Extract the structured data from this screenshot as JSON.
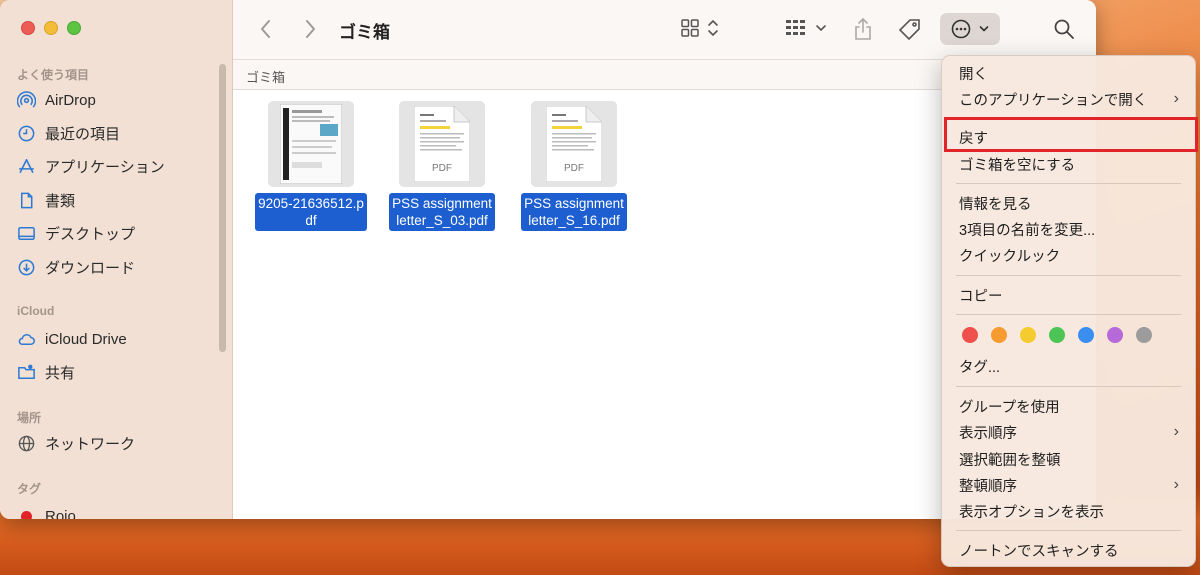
{
  "window": {
    "title": "ゴミ箱",
    "path": "ゴミ箱"
  },
  "sidebar": {
    "sections": {
      "favorites": "よく使う項目",
      "icloud": "iCloud",
      "locations": "場所",
      "tags": "タグ"
    },
    "favorites": [
      {
        "label": "AirDrop",
        "icon": "airdrop-icon"
      },
      {
        "label": "最近の項目",
        "icon": "clock-icon"
      },
      {
        "label": "アプリケーション",
        "icon": "applications-icon"
      },
      {
        "label": "書類",
        "icon": "document-icon"
      },
      {
        "label": "デスクトップ",
        "icon": "desktop-icon"
      },
      {
        "label": "ダウンロード",
        "icon": "download-icon"
      }
    ],
    "icloud": [
      {
        "label": "iCloud Drive",
        "icon": "cloud-icon"
      },
      {
        "label": "共有",
        "icon": "shared-folder-icon"
      }
    ],
    "locations": [
      {
        "label": "ネットワーク",
        "icon": "globe-icon"
      }
    ],
    "tags": [
      {
        "label": "Rojo",
        "color": "#e0242a"
      }
    ]
  },
  "files": [
    {
      "name": "9205-21636512.pdf",
      "line1": "9205-21636512.p",
      "line2": "df",
      "type": "scan"
    },
    {
      "name": "PSS assignment letter_S_03.pdf",
      "line1": "PSS assignment",
      "line2": "letter_S_03.pdf",
      "type": "pdf",
      "badge": "PDF"
    },
    {
      "name": "PSS assignment letter_S_16.pdf",
      "line1": "PSS assignment",
      "line2": "letter_S_16.pdf",
      "type": "pdf",
      "badge": "PDF"
    }
  ],
  "context_menu": {
    "open": "開く",
    "open_with": "このアプリケーションで開く",
    "put_back": "戻す",
    "empty_trash": "ゴミ箱を空にする",
    "get_info": "情報を見る",
    "rename": "3項目の名前を変更...",
    "quick_look": "クイックルック",
    "copy": "コピー",
    "tags": "タグ...",
    "use_groups": "グループを使用",
    "sort_by": "表示順序",
    "clean_up_selection": "選択範囲を整頓",
    "clean_up_by": "整頓順序",
    "show_view_options": "表示オプションを表示",
    "scan_norton": "ノートンでスキャンする",
    "highlighted_item": "戻す",
    "tag_colors": [
      "#f0504b",
      "#f59b30",
      "#f5cc2f",
      "#4cc556",
      "#3a8ef0",
      "#b56ad8",
      "#9c9c9c"
    ]
  }
}
